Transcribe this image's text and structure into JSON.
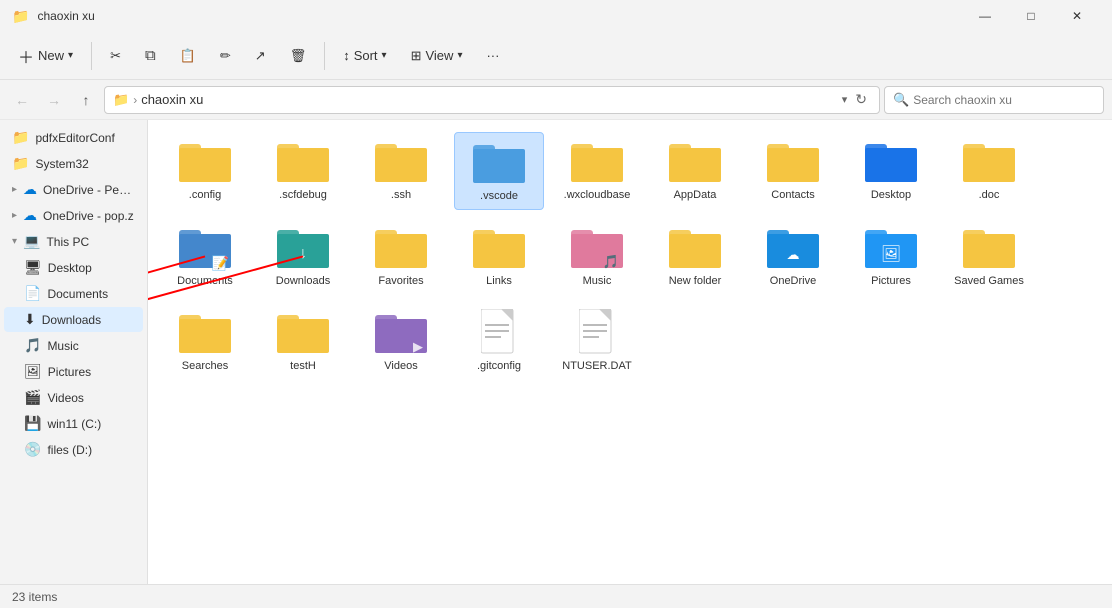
{
  "titleBar": {
    "icon": "📁",
    "title": "chaoxin xu",
    "minimizeLabel": "—",
    "maximizeLabel": "□",
    "closeLabel": "✕"
  },
  "toolbar": {
    "newLabel": "New",
    "cutLabel": "✂",
    "copyLabel": "⧉",
    "pasteLabel": "📋",
    "renameLabel": "✏",
    "shareLabel": "↗",
    "deleteLabel": "🗑",
    "sortLabel": "Sort",
    "viewLabel": "View",
    "moreLabel": "···"
  },
  "addressBar": {
    "folderIcon": "📁",
    "path": "chaoxin xu",
    "searchPlaceholder": "Search chaoxin xu",
    "refreshIcon": "↻"
  },
  "sidebar": {
    "items": [
      {
        "id": "pdfedit",
        "icon": "📁",
        "label": "pdfxEditorConf",
        "indent": 0
      },
      {
        "id": "system32",
        "icon": "📁",
        "label": "System32",
        "indent": 0
      },
      {
        "id": "onedrive1",
        "icon": "☁",
        "label": "OneDrive - Perso",
        "indent": 0,
        "color": "#0078d4"
      },
      {
        "id": "onedrive2",
        "icon": "☁",
        "label": "OneDrive - pop.z",
        "indent": 0,
        "color": "#0078d4"
      },
      {
        "id": "thispc",
        "icon": "💻",
        "label": "This PC",
        "indent": 0,
        "expanded": true
      },
      {
        "id": "desktop",
        "icon": "🖥",
        "label": "Desktop",
        "indent": 1
      },
      {
        "id": "documents",
        "icon": "📄",
        "label": "Documents",
        "indent": 1
      },
      {
        "id": "downloads",
        "icon": "⬇",
        "label": "Downloads",
        "indent": 1,
        "active": true
      },
      {
        "id": "music",
        "icon": "🎵",
        "label": "Music",
        "indent": 1
      },
      {
        "id": "pictures",
        "icon": "🖼",
        "label": "Pictures",
        "indent": 1
      },
      {
        "id": "videos",
        "icon": "🎬",
        "label": "Videos",
        "indent": 1
      },
      {
        "id": "winc",
        "icon": "💾",
        "label": "win11 (C:)",
        "indent": 1
      },
      {
        "id": "filesd",
        "icon": "💿",
        "label": "files (D:)",
        "indent": 1
      }
    ]
  },
  "files": [
    {
      "id": "config",
      "type": "folder",
      "color": "yellow",
      "label": ".config"
    },
    {
      "id": "scfdebug",
      "type": "folder",
      "color": "yellow",
      "label": ".scfdebug"
    },
    {
      "id": "ssh",
      "type": "folder",
      "color": "yellow",
      "label": ".ssh"
    },
    {
      "id": "vscode",
      "type": "folder",
      "color": "blue-outline",
      "label": ".vscode",
      "selected": true
    },
    {
      "id": "wxcloudbase",
      "type": "folder",
      "color": "yellow",
      "label": ".wxcloudbase"
    },
    {
      "id": "appdata",
      "type": "folder",
      "color": "yellow",
      "label": "AppData"
    },
    {
      "id": "contacts",
      "type": "folder",
      "color": "yellow",
      "label": "Contacts"
    },
    {
      "id": "desktop2",
      "type": "folder",
      "color": "darkblue",
      "label": "Desktop"
    },
    {
      "id": "doc2",
      "type": "folder",
      "color": "yellow",
      "label": ".doc"
    },
    {
      "id": "documents2",
      "type": "folder",
      "color": "doc",
      "label": "Documents"
    },
    {
      "id": "downloads2",
      "type": "folder",
      "color": "teal-dl",
      "label": "Downloads"
    },
    {
      "id": "favorites",
      "type": "folder",
      "color": "yellow",
      "label": "Favorites"
    },
    {
      "id": "links",
      "type": "folder",
      "color": "yellow",
      "label": "Links"
    },
    {
      "id": "music2",
      "type": "folder",
      "color": "pink",
      "label": "Music"
    },
    {
      "id": "newfolder",
      "type": "folder",
      "color": "yellow",
      "label": "New folder"
    },
    {
      "id": "onedrive3",
      "type": "folder",
      "color": "blue2",
      "label": "OneDrive"
    },
    {
      "id": "pictures2",
      "type": "folder",
      "color": "blue3",
      "label": "Pictures"
    },
    {
      "id": "savedgames",
      "type": "folder",
      "color": "yellow",
      "label": "Saved Games"
    },
    {
      "id": "searches",
      "type": "folder",
      "color": "yellow",
      "label": "Searches"
    },
    {
      "id": "testh",
      "type": "folder",
      "color": "yellow",
      "label": "testH"
    },
    {
      "id": "videos2",
      "type": "folder",
      "color": "purple",
      "label": "Videos"
    },
    {
      "id": "gitconfig",
      "type": "doc",
      "label": ".gitconfig"
    },
    {
      "id": "ntuserdat",
      "type": "doc",
      "label": "NTUSER.DAT"
    }
  ],
  "statusBar": {
    "count": "23 items"
  }
}
